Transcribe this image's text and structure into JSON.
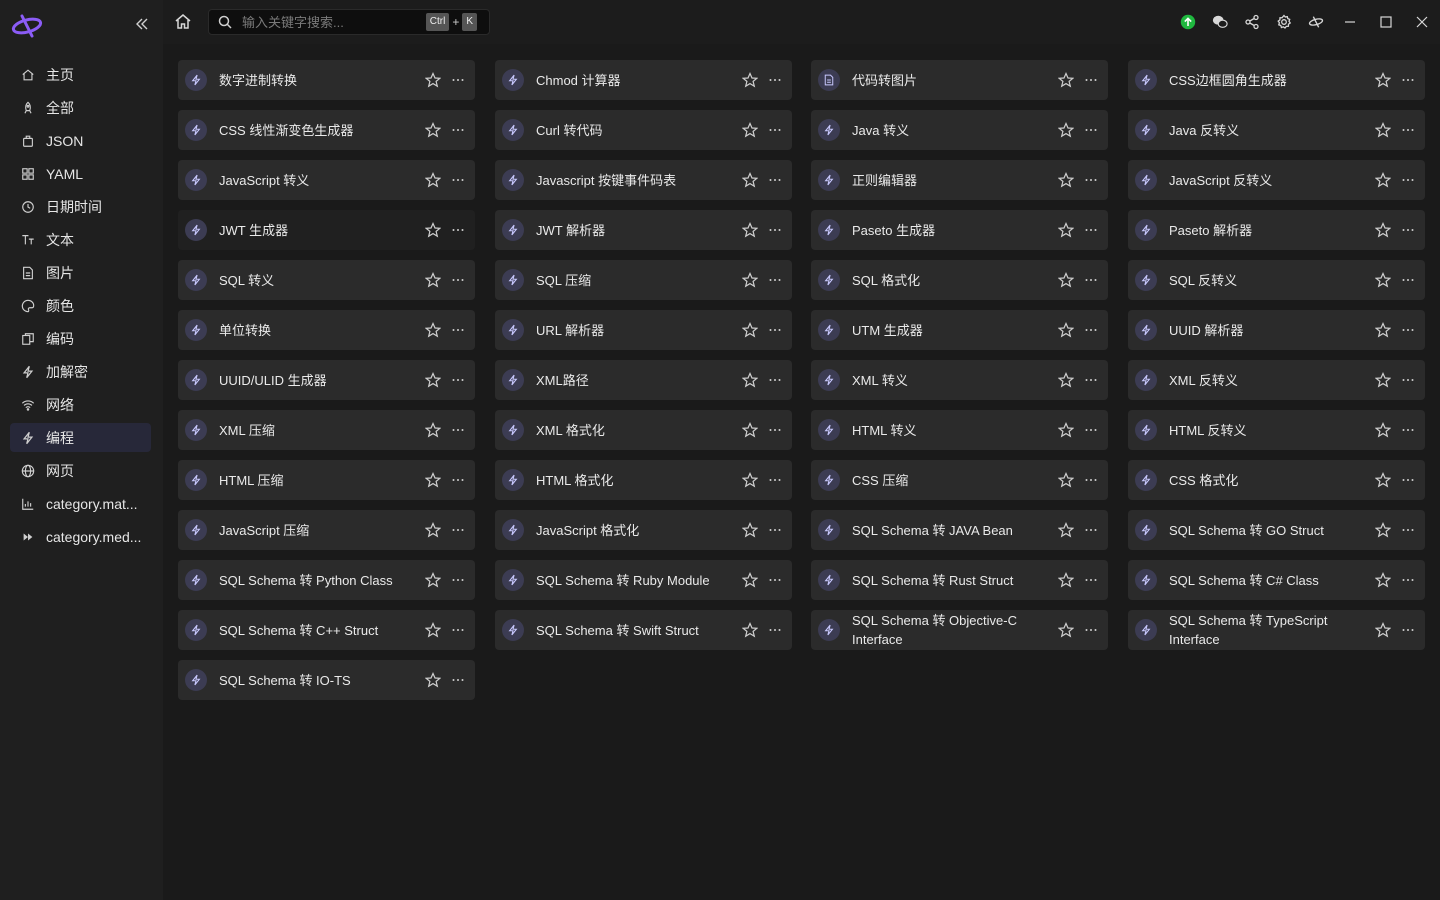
{
  "sidebar": {
    "collapse_icon": "double-chevron-left-icon",
    "items": [
      {
        "label": "主页",
        "icon": "home-icon",
        "active": false
      },
      {
        "label": "全部",
        "icon": "rocket-icon",
        "active": false
      },
      {
        "label": "JSON",
        "icon": "json-icon",
        "active": false
      },
      {
        "label": "YAML",
        "icon": "grid-icon",
        "active": false
      },
      {
        "label": "日期时间",
        "icon": "clock-icon",
        "active": false
      },
      {
        "label": "文本",
        "icon": "text-icon",
        "active": false
      },
      {
        "label": "图片",
        "icon": "image-icon",
        "active": false
      },
      {
        "label": "颜色",
        "icon": "palette-icon",
        "active": false
      },
      {
        "label": "编码",
        "icon": "code-icon",
        "active": false
      },
      {
        "label": "加解密",
        "icon": "bolt-icon",
        "active": false
      },
      {
        "label": "网络",
        "icon": "wifi-icon",
        "active": false
      },
      {
        "label": "编程",
        "icon": "bolt-icon",
        "active": true
      },
      {
        "label": "网页",
        "icon": "globe-icon",
        "active": false
      },
      {
        "label": "category.mat...",
        "icon": "chart-icon",
        "active": false
      },
      {
        "label": "category.med...",
        "icon": "forward-icon",
        "active": false
      }
    ]
  },
  "topbar": {
    "search_placeholder": "输入关键字搜索...",
    "shortcut_key1": "Ctrl",
    "shortcut_plus": "+",
    "shortcut_key2": "K"
  },
  "colors": {
    "accent": "#3c3c53",
    "update": "#1fb83f",
    "card": "#2b2b2b",
    "active_nav": "#272839"
  },
  "tools": [
    {
      "label": "数字进制转换",
      "icon": "bolt-icon"
    },
    {
      "label": "Chmod 计算器",
      "icon": "bolt-icon"
    },
    {
      "label": "代码转图片",
      "icon": "file-icon"
    },
    {
      "label": "CSS边框圆角生成器",
      "icon": "bolt-icon"
    },
    {
      "label": "CSS 线性渐变色生成器",
      "icon": "bolt-icon"
    },
    {
      "label": "Curl 转代码",
      "icon": "bolt-icon"
    },
    {
      "label": "Java 转义",
      "icon": "bolt-icon"
    },
    {
      "label": "Java 反转义",
      "icon": "bolt-icon"
    },
    {
      "label": "JavaScript 转义",
      "icon": "bolt-icon"
    },
    {
      "label": "Javascript 按键事件码表",
      "icon": "bolt-icon"
    },
    {
      "label": "正则编辑器",
      "icon": "bolt-icon"
    },
    {
      "label": "JavaScript 反转义",
      "icon": "bolt-icon"
    },
    {
      "label": "JWT 生成器",
      "icon": "bolt-icon",
      "hover": true
    },
    {
      "label": "JWT 解析器",
      "icon": "bolt-icon"
    },
    {
      "label": "Paseto 生成器",
      "icon": "bolt-icon"
    },
    {
      "label": "Paseto 解析器",
      "icon": "bolt-icon"
    },
    {
      "label": "SQL 转义",
      "icon": "bolt-icon"
    },
    {
      "label": "SQL 压缩",
      "icon": "bolt-icon"
    },
    {
      "label": "SQL 格式化",
      "icon": "bolt-icon"
    },
    {
      "label": "SQL 反转义",
      "icon": "bolt-icon"
    },
    {
      "label": "单位转换",
      "icon": "bolt-icon"
    },
    {
      "label": "URL 解析器",
      "icon": "bolt-icon"
    },
    {
      "label": "UTM 生成器",
      "icon": "bolt-icon"
    },
    {
      "label": "UUID 解析器",
      "icon": "bolt-icon"
    },
    {
      "label": "UUID/ULID 生成器",
      "icon": "bolt-icon"
    },
    {
      "label": "XML路径",
      "icon": "bolt-icon"
    },
    {
      "label": "XML 转义",
      "icon": "bolt-icon"
    },
    {
      "label": "XML 反转义",
      "icon": "bolt-icon"
    },
    {
      "label": "XML 压缩",
      "icon": "bolt-icon"
    },
    {
      "label": "XML 格式化",
      "icon": "bolt-icon"
    },
    {
      "label": "HTML 转义",
      "icon": "bolt-icon"
    },
    {
      "label": "HTML 反转义",
      "icon": "bolt-icon"
    },
    {
      "label": "HTML 压缩",
      "icon": "bolt-icon"
    },
    {
      "label": "HTML 格式化",
      "icon": "bolt-icon"
    },
    {
      "label": "CSS 压缩",
      "icon": "bolt-icon"
    },
    {
      "label": "CSS 格式化",
      "icon": "bolt-icon"
    },
    {
      "label": "JavaScript 压缩",
      "icon": "bolt-icon"
    },
    {
      "label": "JavaScript 格式化",
      "icon": "bolt-icon"
    },
    {
      "label": "SQL Schema 转 JAVA Bean",
      "icon": "bolt-icon"
    },
    {
      "label": "SQL Schema 转 GO Struct",
      "icon": "bolt-icon"
    },
    {
      "label": "SQL Schema 转 Python Class",
      "icon": "bolt-icon"
    },
    {
      "label": "SQL Schema 转 Ruby Module",
      "icon": "bolt-icon"
    },
    {
      "label": "SQL Schema 转 Rust Struct",
      "icon": "bolt-icon"
    },
    {
      "label": "SQL Schema 转 C# Class",
      "icon": "bolt-icon"
    },
    {
      "label": "SQL Schema 转 C++ Struct",
      "icon": "bolt-icon"
    },
    {
      "label": "SQL Schema 转 Swift Struct",
      "icon": "bolt-icon"
    },
    {
      "label": "SQL Schema 转 Objective-C Interface",
      "icon": "bolt-icon"
    },
    {
      "label": "SQL Schema 转 TypeScript Interface",
      "icon": "bolt-icon"
    },
    {
      "label": "SQL Schema 转 IO-TS",
      "icon": "bolt-icon"
    }
  ]
}
